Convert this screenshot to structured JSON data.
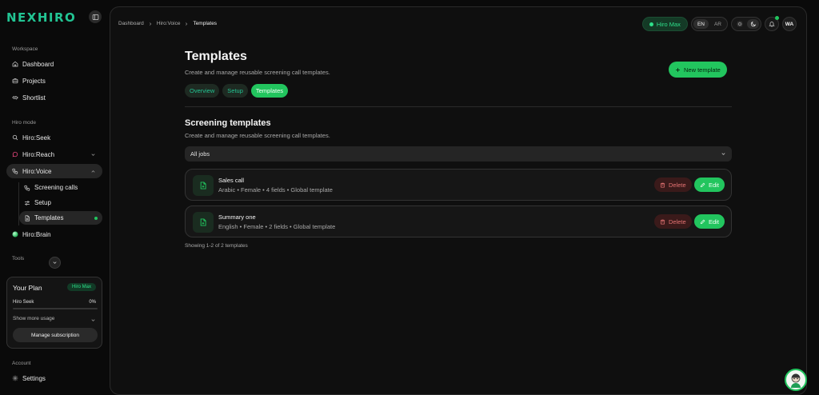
{
  "brand": {
    "logo": "NEXHIRO"
  },
  "sidebar": {
    "workspace_label": "Workspace",
    "workspace_items": [
      {
        "label": "Dashboard",
        "icon": "home-icon"
      },
      {
        "label": "Projects",
        "icon": "briefcase-icon"
      },
      {
        "label": "Shortlist",
        "icon": "handshake-icon"
      }
    ],
    "mode_label": "Hiro mode",
    "modes": [
      {
        "label": "Hiro:Seek",
        "icon": "search-icon"
      },
      {
        "label": "Hiro:Reach",
        "icon": "chat-icon"
      },
      {
        "label": "Hiro:Voice",
        "icon": "phone-icon",
        "expanded": true
      },
      {
        "label": "Hiro:Brain",
        "icon": "brain-orb-icon"
      }
    ],
    "voice_items": [
      {
        "label": "Screening calls",
        "icon": "phone-icon"
      },
      {
        "label": "Setup",
        "icon": "sliders-icon"
      },
      {
        "label": "Templates",
        "icon": "file-icon",
        "active": true
      }
    ],
    "tools_label": "Tools",
    "plan": {
      "title": "Your Plan",
      "badge": "Hiro Max",
      "usage_label": "Hiro Seek",
      "usage_value": "0%",
      "usage_fraction": 0,
      "more_usage": "Show more usage",
      "manage_button": "Manage subscription"
    },
    "account_label": "Account",
    "settings": "Settings"
  },
  "header": {
    "breadcrumb": [
      "Dashboard",
      "Hiro:Voice",
      "Templates"
    ],
    "plan_pill": "Hiro Max",
    "languages": [
      "EN",
      "AR"
    ],
    "selected_language": "EN",
    "avatar_initials": "WA"
  },
  "page": {
    "title": "Templates",
    "subtitle": "Create and manage reusable screening call templates.",
    "new_button": "New template",
    "tabs": [
      "Overview",
      "Setup",
      "Templates"
    ],
    "active_tab": "Templates",
    "section_title": "Screening templates",
    "section_subtitle": "Create and manage reusable screening call templates.",
    "job_filter": "All jobs",
    "templates": [
      {
        "name": "Sales call",
        "meta": "Arabic • Female • 4 fields • Global template"
      },
      {
        "name": "Summary one",
        "meta": "English • Female • 2 fields • Global template"
      }
    ],
    "delete_label": "Delete",
    "edit_label": "Edit",
    "showing": "Showing 1-2 of 2 templates"
  },
  "colors": {
    "accent": "#22c55e",
    "brand": "#22c493",
    "danger_text": "#e57373",
    "background": "#0a0a0a",
    "panel": "#0f0f0f"
  }
}
